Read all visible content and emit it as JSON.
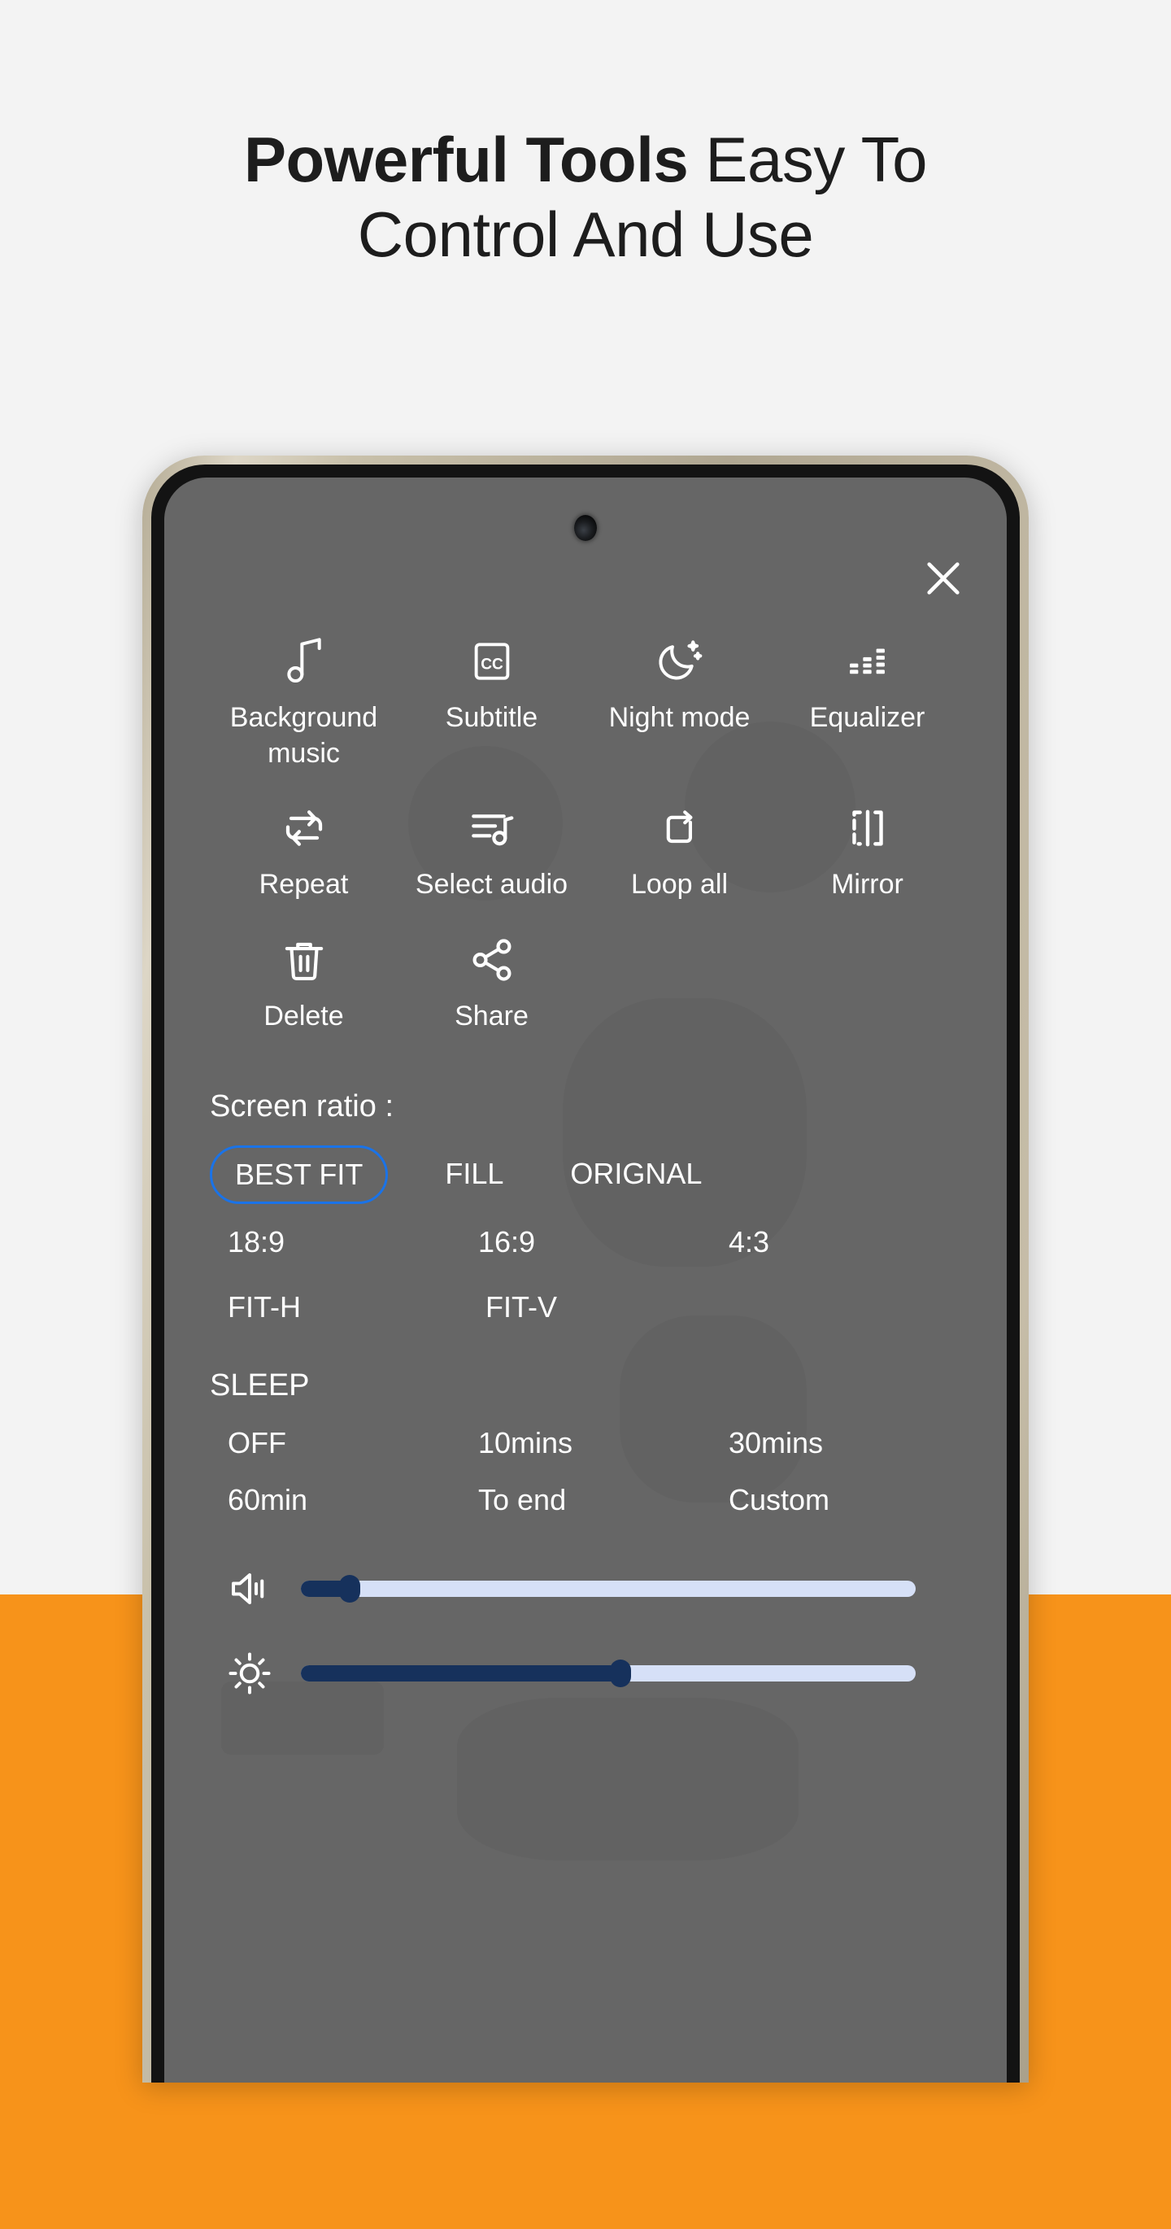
{
  "headline": {
    "bold_part": "Powerful Tools",
    "rest_part": " Easy To",
    "line2": "Control And Use"
  },
  "colors": {
    "page_background": "#f3f3f3",
    "accent_orange": "#f7931a",
    "screen_overlay": "#666666",
    "selected_border": "#1a73e8",
    "slider_fill": "#16315c",
    "slider_track": "#d6e0f7",
    "phone_frame": "#c8c0aa",
    "text_on_screen": "#ffffff"
  },
  "screen": {
    "close_icon": "close-icon",
    "camera_icon": "front-camera-punch-hole",
    "tools": [
      {
        "label": "Background music",
        "icon": "music-note-icon"
      },
      {
        "label": "Subtitle",
        "icon": "closed-caption-icon"
      },
      {
        "label": "Night mode",
        "icon": "moon-stars-icon"
      },
      {
        "label": "Equalizer",
        "icon": "equalizer-icon"
      },
      {
        "label": "Repeat",
        "icon": "repeat-icon"
      },
      {
        "label": "Select audio",
        "icon": "audio-track-list-icon"
      },
      {
        "label": "Loop all",
        "icon": "loop-all-icon"
      },
      {
        "label": "Mirror",
        "icon": "mirror-icon"
      },
      {
        "label": "Delete",
        "icon": "trash-icon"
      },
      {
        "label": "Share",
        "icon": "share-nodes-icon"
      }
    ],
    "screen_ratio": {
      "title": "Screen ratio :",
      "selected": "BEST FIT",
      "row1": [
        "BEST FIT",
        "FILL",
        "ORIGNAL"
      ],
      "row2": [
        "18:9",
        "16:9",
        "4:3"
      ],
      "row3": [
        "FIT-H",
        "FIT-V"
      ]
    },
    "sleep": {
      "title": "SLEEP",
      "row1": [
        "OFF",
        "10mins",
        "30mins"
      ],
      "row2": [
        "60min",
        "To end",
        "Custom"
      ]
    },
    "sliders": [
      {
        "name": "volume",
        "icon": "volume-icon",
        "value_percent": 8
      },
      {
        "name": "brightness",
        "icon": "brightness-icon",
        "value_percent": 52
      }
    ]
  }
}
